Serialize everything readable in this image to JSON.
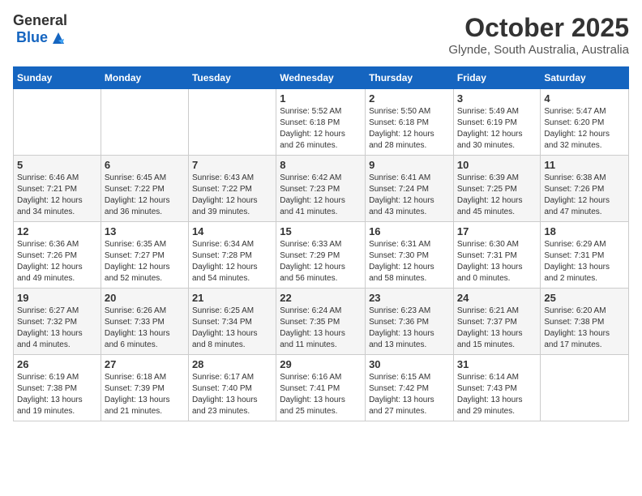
{
  "logo": {
    "general": "General",
    "blue": "Blue"
  },
  "header": {
    "month": "October 2025",
    "location": "Glynde, South Australia, Australia"
  },
  "weekdays": [
    "Sunday",
    "Monday",
    "Tuesday",
    "Wednesday",
    "Thursday",
    "Friday",
    "Saturday"
  ],
  "weeks": [
    [
      {
        "day": "",
        "info": ""
      },
      {
        "day": "",
        "info": ""
      },
      {
        "day": "",
        "info": ""
      },
      {
        "day": "1",
        "info": "Sunrise: 5:52 AM\nSunset: 6:18 PM\nDaylight: 12 hours\nand 26 minutes."
      },
      {
        "day": "2",
        "info": "Sunrise: 5:50 AM\nSunset: 6:18 PM\nDaylight: 12 hours\nand 28 minutes."
      },
      {
        "day": "3",
        "info": "Sunrise: 5:49 AM\nSunset: 6:19 PM\nDaylight: 12 hours\nand 30 minutes."
      },
      {
        "day": "4",
        "info": "Sunrise: 5:47 AM\nSunset: 6:20 PM\nDaylight: 12 hours\nand 32 minutes."
      }
    ],
    [
      {
        "day": "5",
        "info": "Sunrise: 6:46 AM\nSunset: 7:21 PM\nDaylight: 12 hours\nand 34 minutes."
      },
      {
        "day": "6",
        "info": "Sunrise: 6:45 AM\nSunset: 7:22 PM\nDaylight: 12 hours\nand 36 minutes."
      },
      {
        "day": "7",
        "info": "Sunrise: 6:43 AM\nSunset: 7:22 PM\nDaylight: 12 hours\nand 39 minutes."
      },
      {
        "day": "8",
        "info": "Sunrise: 6:42 AM\nSunset: 7:23 PM\nDaylight: 12 hours\nand 41 minutes."
      },
      {
        "day": "9",
        "info": "Sunrise: 6:41 AM\nSunset: 7:24 PM\nDaylight: 12 hours\nand 43 minutes."
      },
      {
        "day": "10",
        "info": "Sunrise: 6:39 AM\nSunset: 7:25 PM\nDaylight: 12 hours\nand 45 minutes."
      },
      {
        "day": "11",
        "info": "Sunrise: 6:38 AM\nSunset: 7:26 PM\nDaylight: 12 hours\nand 47 minutes."
      }
    ],
    [
      {
        "day": "12",
        "info": "Sunrise: 6:36 AM\nSunset: 7:26 PM\nDaylight: 12 hours\nand 49 minutes."
      },
      {
        "day": "13",
        "info": "Sunrise: 6:35 AM\nSunset: 7:27 PM\nDaylight: 12 hours\nand 52 minutes."
      },
      {
        "day": "14",
        "info": "Sunrise: 6:34 AM\nSunset: 7:28 PM\nDaylight: 12 hours\nand 54 minutes."
      },
      {
        "day": "15",
        "info": "Sunrise: 6:33 AM\nSunset: 7:29 PM\nDaylight: 12 hours\nand 56 minutes."
      },
      {
        "day": "16",
        "info": "Sunrise: 6:31 AM\nSunset: 7:30 PM\nDaylight: 12 hours\nand 58 minutes."
      },
      {
        "day": "17",
        "info": "Sunrise: 6:30 AM\nSunset: 7:31 PM\nDaylight: 13 hours\nand 0 minutes."
      },
      {
        "day": "18",
        "info": "Sunrise: 6:29 AM\nSunset: 7:31 PM\nDaylight: 13 hours\nand 2 minutes."
      }
    ],
    [
      {
        "day": "19",
        "info": "Sunrise: 6:27 AM\nSunset: 7:32 PM\nDaylight: 13 hours\nand 4 minutes."
      },
      {
        "day": "20",
        "info": "Sunrise: 6:26 AM\nSunset: 7:33 PM\nDaylight: 13 hours\nand 6 minutes."
      },
      {
        "day": "21",
        "info": "Sunrise: 6:25 AM\nSunset: 7:34 PM\nDaylight: 13 hours\nand 8 minutes."
      },
      {
        "day": "22",
        "info": "Sunrise: 6:24 AM\nSunset: 7:35 PM\nDaylight: 13 hours\nand 11 minutes."
      },
      {
        "day": "23",
        "info": "Sunrise: 6:23 AM\nSunset: 7:36 PM\nDaylight: 13 hours\nand 13 minutes."
      },
      {
        "day": "24",
        "info": "Sunrise: 6:21 AM\nSunset: 7:37 PM\nDaylight: 13 hours\nand 15 minutes."
      },
      {
        "day": "25",
        "info": "Sunrise: 6:20 AM\nSunset: 7:38 PM\nDaylight: 13 hours\nand 17 minutes."
      }
    ],
    [
      {
        "day": "26",
        "info": "Sunrise: 6:19 AM\nSunset: 7:38 PM\nDaylight: 13 hours\nand 19 minutes."
      },
      {
        "day": "27",
        "info": "Sunrise: 6:18 AM\nSunset: 7:39 PM\nDaylight: 13 hours\nand 21 minutes."
      },
      {
        "day": "28",
        "info": "Sunrise: 6:17 AM\nSunset: 7:40 PM\nDaylight: 13 hours\nand 23 minutes."
      },
      {
        "day": "29",
        "info": "Sunrise: 6:16 AM\nSunset: 7:41 PM\nDaylight: 13 hours\nand 25 minutes."
      },
      {
        "day": "30",
        "info": "Sunrise: 6:15 AM\nSunset: 7:42 PM\nDaylight: 13 hours\nand 27 minutes."
      },
      {
        "day": "31",
        "info": "Sunrise: 6:14 AM\nSunset: 7:43 PM\nDaylight: 13 hours\nand 29 minutes."
      },
      {
        "day": "",
        "info": ""
      }
    ]
  ]
}
